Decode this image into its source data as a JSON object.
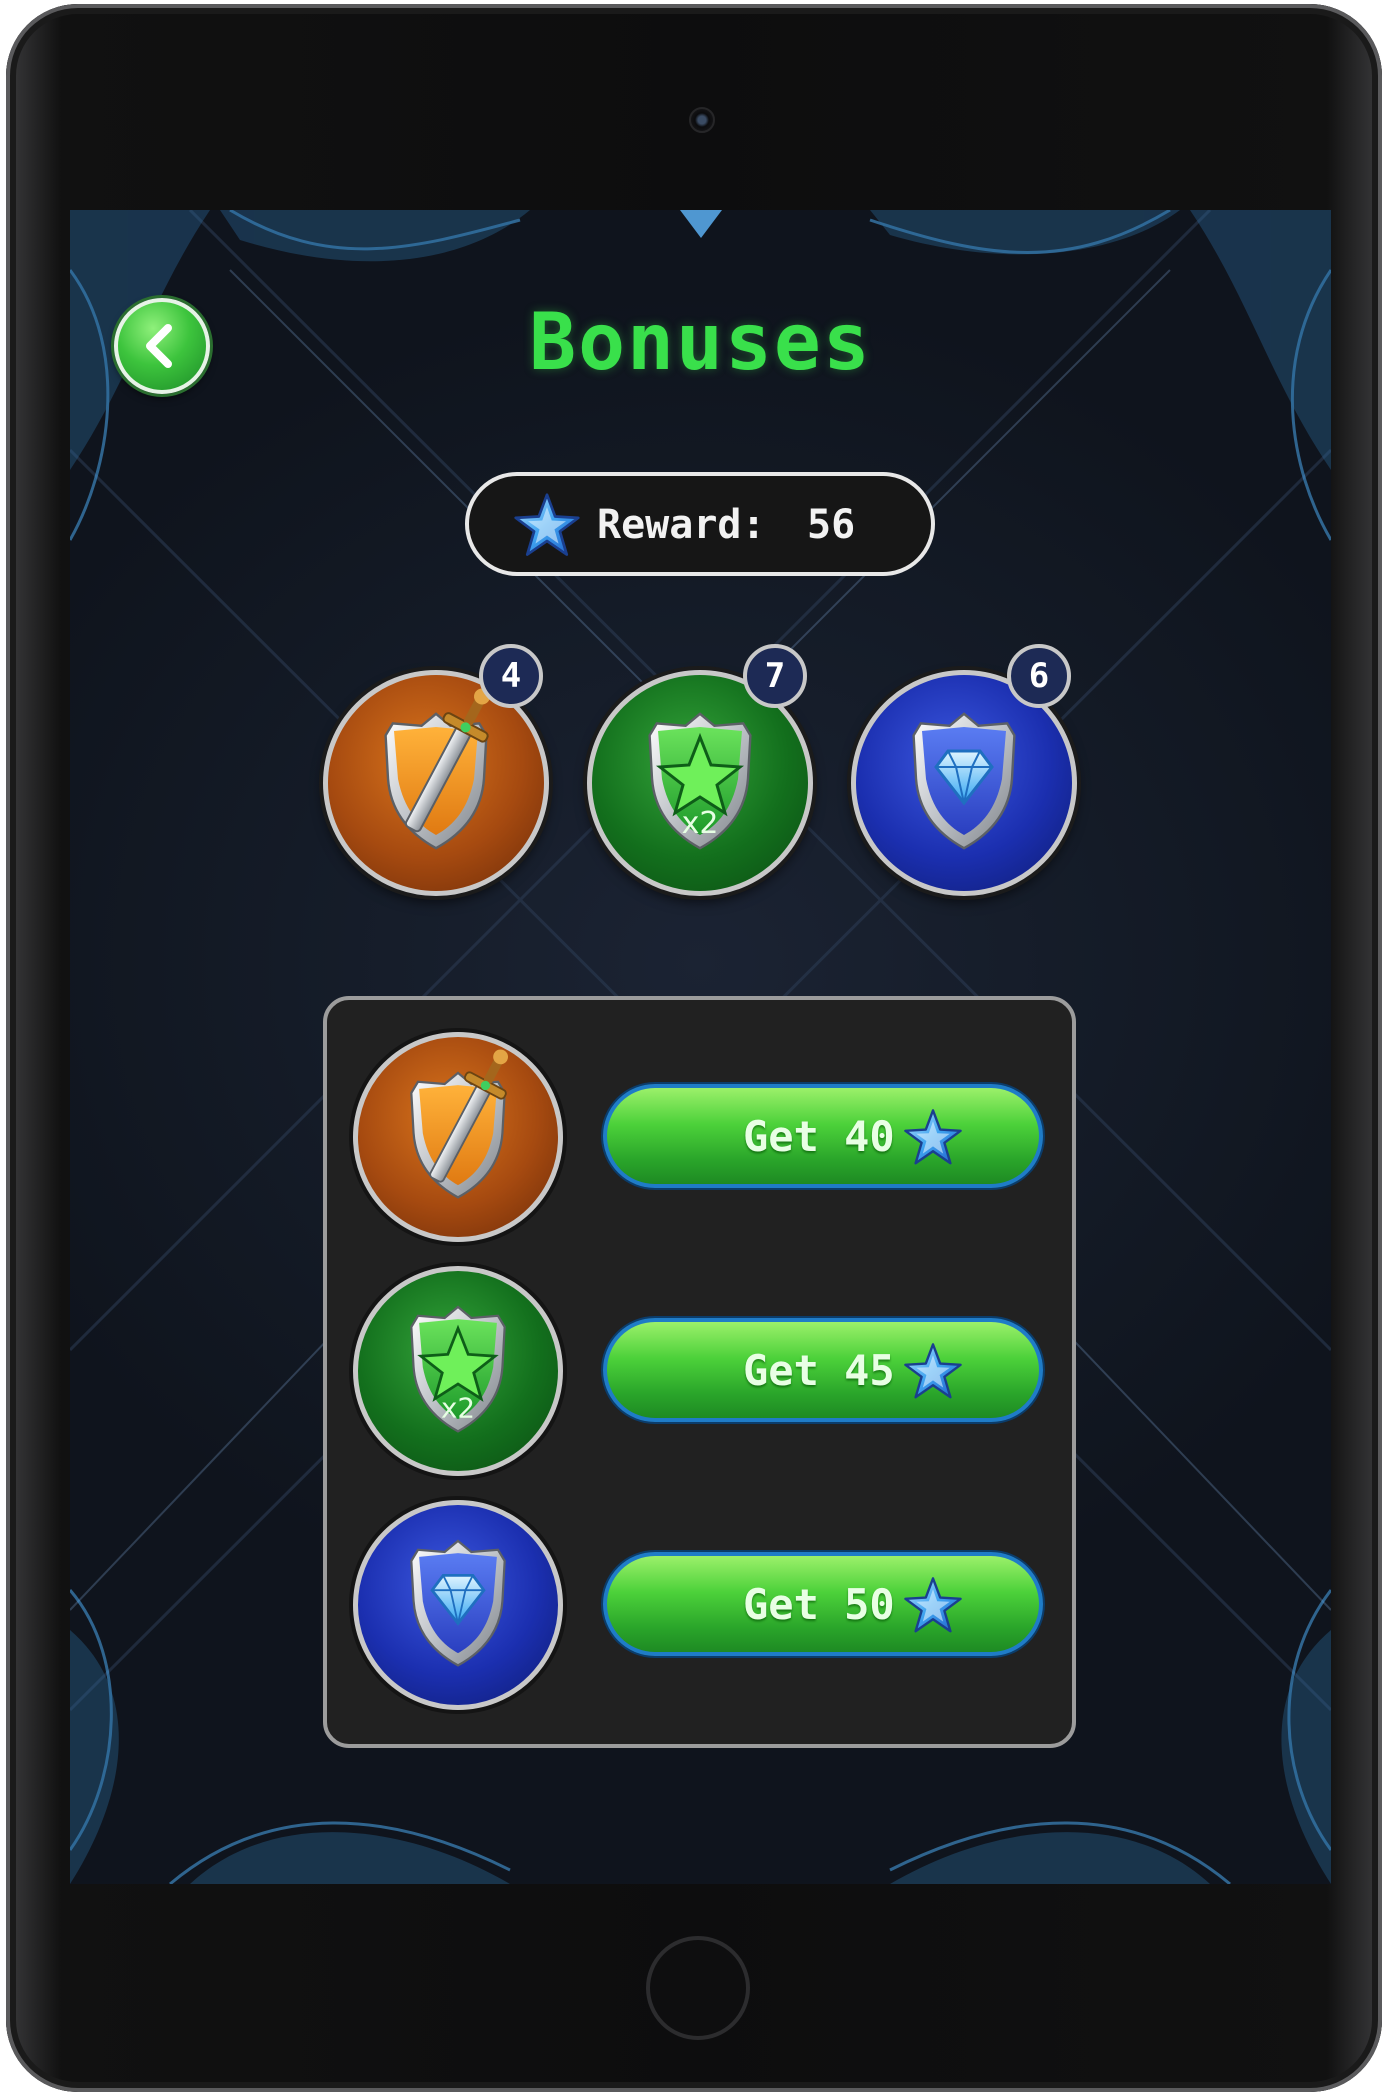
{
  "screen": {
    "title": "Bonuses",
    "back_icon": "chevron-left-icon"
  },
  "reward": {
    "label": "Reward:",
    "value": "56",
    "icon": "blue-star-icon"
  },
  "bonuses": [
    {
      "id": "sword",
      "icon": "sword-shield-icon",
      "color": "#c0631a",
      "count": "4"
    },
    {
      "id": "double-stars",
      "icon": "star-shield-icon",
      "color": "#1c8a27",
      "count": "7",
      "multiplier": "x2"
    },
    {
      "id": "diamond",
      "icon": "diamond-shield-icon",
      "color": "#2238c4",
      "count": "6"
    }
  ],
  "shop": [
    {
      "id": "sword",
      "icon": "sword-shield-icon",
      "button_label": "Get 40",
      "button_icon": "blue-star-icon"
    },
    {
      "id": "double-stars",
      "icon": "star-shield-icon",
      "multiplier": "x2",
      "button_label": "Get 45",
      "button_icon": "blue-star-icon"
    },
    {
      "id": "diamond",
      "icon": "diamond-shield-icon",
      "button_label": "Get 50",
      "button_icon": "blue-star-icon"
    }
  ],
  "colors": {
    "title": "#39e04b",
    "button_green": "#3cc43a",
    "button_border": "#1f7cc7",
    "panel": "#212121"
  }
}
